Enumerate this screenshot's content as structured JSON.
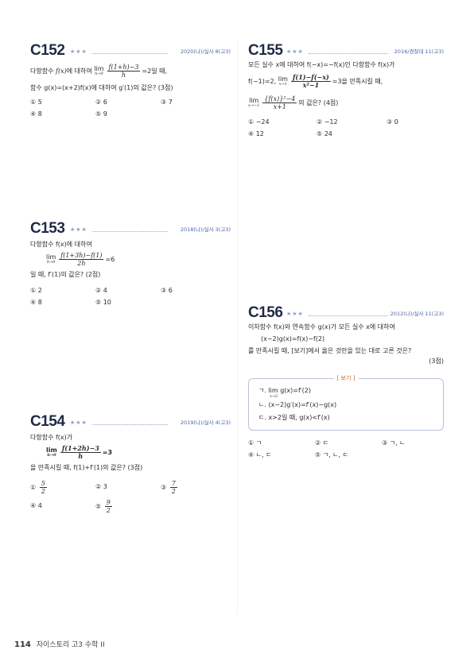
{
  "footer": {
    "page": "114",
    "title": "자이스토리 고3 수학 II"
  },
  "problems": {
    "c152": {
      "num": "C152",
      "stars": "★★★",
      "source": "2020(나)/실사 8(고3)",
      "l1a": "다항함수",
      "l1b": "f(x)",
      "l1c": "에 대하여",
      "lim": "lim",
      "limsub": "h→0",
      "fnum": "f(1+h)−3",
      "fden": "h",
      "l1d": "=2일 때,",
      "l2": "함수 g(x)=(x+2)f(x)에 대하여 g′(1)의 값은? (3점)",
      "choices": [
        "① 5",
        "② 6",
        "③ 7",
        "④ 8",
        "⑤ 9"
      ]
    },
    "c153": {
      "num": "C153",
      "stars": "★★★",
      "source": "2018(나)/실사 3(고3)",
      "l1": "다항함수 f(x)에 대하여",
      "lim": "lim",
      "limsub": "h→0",
      "fnum": "f(1+3h)−f(1)",
      "fden": "2h",
      "eq": "=6",
      "l3": "일 때, f′(1)의 값은? (2점)",
      "choices": [
        "① 2",
        "② 4",
        "③ 6",
        "④ 8",
        "⑤ 10"
      ]
    },
    "c154": {
      "num": "C154",
      "stars": "★★★",
      "source": "2019(나)/실사 4(고3)",
      "l1": "다항함수 f(x)가",
      "lim": "lim",
      "limsub": "h→0",
      "fnum": "f(1+2h)−3",
      "fden": "h",
      "eq": "=3",
      "l3": "을 만족시킬 때, f(1)+f′(1)의 값은? (3점)",
      "choices": [
        {
          "n": "①",
          "nu": "5",
          "de": "2"
        },
        {
          "n": "② 3"
        },
        {
          "n": "③",
          "nu": "7",
          "de": "2"
        },
        {
          "n": "④ 4"
        },
        {
          "n": "⑤",
          "nu": "9",
          "de": "2"
        }
      ]
    },
    "c155": {
      "num": "C155",
      "stars": "★★★",
      "source": "2016/경찰대 11(고3)",
      "l1": "모든 실수 x에 대하여 f(−x)=−f(x)인 다항함수 f(x)가",
      "l2a": "f(−1)=2,",
      "lim": "lim",
      "limsub": "x→1",
      "fnum": "f(1)−f(−x)",
      "fden": "x²−1",
      "l2b": "=3을 만족시킬 때,",
      "lim2": "lim",
      "lim2sub": "x→−1",
      "fnum2": "{f(x)}²−4",
      "fden2": "x+1",
      "l3b": "의 값은? (4점)",
      "choices": [
        "① −24",
        "② −12",
        "③ 0",
        "④ 12",
        "⑤ 24"
      ]
    },
    "c156": {
      "num": "C156",
      "stars": "★★★",
      "source": "2012(나)/실사 11(고3)",
      "l1": "이차함수 f(x)와 연속함수 g(x)가 모든 실수 x에 대하여",
      "l2": "(x−2)g(x)=f(x)−f(2)",
      "l3": "를 만족시킬 때, [보기]에서 옳은 것만을 있는 대로 고른 것은?",
      "pts": "(3점)",
      "bogi_title": "[ 보기 ]",
      "bogi": [
        "ㄱ. lim g(x)=f′(2)",
        "ㄴ. (x−2)g′(x)=f′(x)−g(x)",
        "ㄷ. x>2일 때, g(x)<f′(x)"
      ],
      "bogi_sub": "x→2",
      "choices": [
        "① ㄱ",
        "② ㄷ",
        "③ ㄱ, ㄴ",
        "④ ㄴ, ㄷ",
        "⑤ ㄱ, ㄴ, ㄷ"
      ]
    }
  }
}
